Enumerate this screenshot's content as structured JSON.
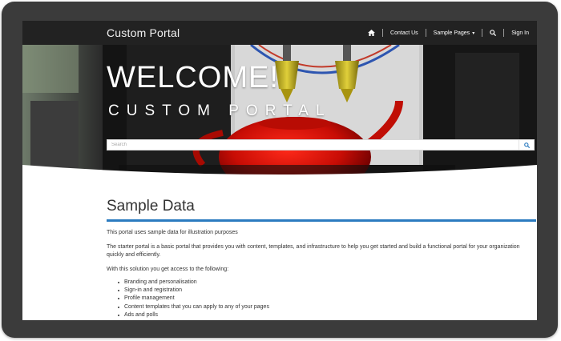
{
  "navbar": {
    "brand": "Custom Portal",
    "contact_label": "Contact Us",
    "sample_pages_label": "Sample Pages",
    "sign_in_label": "Sign In"
  },
  "hero": {
    "title": "WELCOME!",
    "subtitle": "CUSTOM PORTAL",
    "search_placeholder": "Search"
  },
  "content": {
    "title": "Sample Data",
    "paragraphs": [
      "This portal uses sample data for illustration purposes",
      "The starter portal is a basic portal that provides you with content, templates, and infrastructure to help you get started and build a functional portal for your organization quickly and efficiently.",
      "With this solution you get access to the following:"
    ],
    "features": [
      "Branding and personalisation",
      "Sign-in and registration",
      "Profile management",
      "Content templates that you can apply to any of your pages",
      "Ads and polls"
    ]
  },
  "colors": {
    "navbar_bg": "#222222",
    "accent_rule": "#2b7bc0",
    "frame": "#3b3b3b"
  },
  "icons": [
    "home-icon",
    "search-icon",
    "chevron-down-icon"
  ]
}
